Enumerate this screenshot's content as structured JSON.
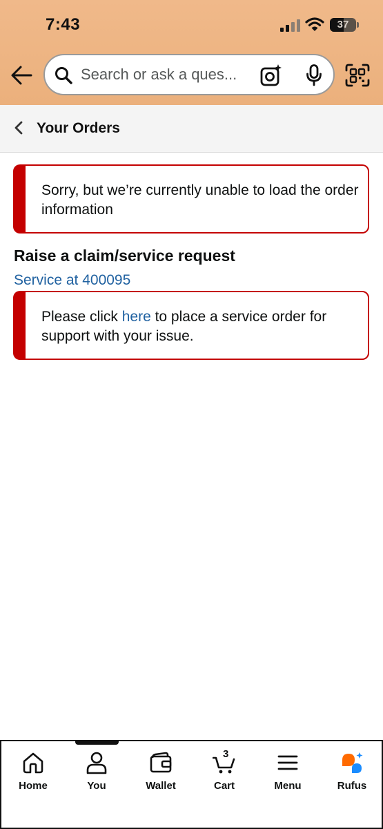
{
  "status_bar": {
    "time": "7:43",
    "battery": "37"
  },
  "header": {
    "search_placeholder": "Search or ask a ques..."
  },
  "page": {
    "title": "Your Orders"
  },
  "alert_load": {
    "text": "Sorry, but we’re currently unable to load the order information"
  },
  "claim_section": {
    "heading": "Raise a claim/service request",
    "service_link": "Service at 400095"
  },
  "alert_service": {
    "prefix": "Please click ",
    "link": "here",
    "suffix": " to place a service order for support with your issue."
  },
  "bottom_nav": {
    "items": [
      {
        "label": "Home",
        "icon": "home-icon"
      },
      {
        "label": "You",
        "icon": "person-icon"
      },
      {
        "label": "Wallet",
        "icon": "wallet-icon"
      },
      {
        "label": "Cart",
        "icon": "cart-icon",
        "badge": "3"
      },
      {
        "label": "Menu",
        "icon": "hamburger-menu-icon"
      },
      {
        "label": "Rufus",
        "icon": "rufus-chat-icon"
      }
    ]
  },
  "colors": {
    "header_bg": "#edb482",
    "alert_red": "#c40000",
    "link_blue": "#2162a1",
    "rufus_orange": "#ff6a00",
    "rufus_blue": "#1a8cff"
  }
}
